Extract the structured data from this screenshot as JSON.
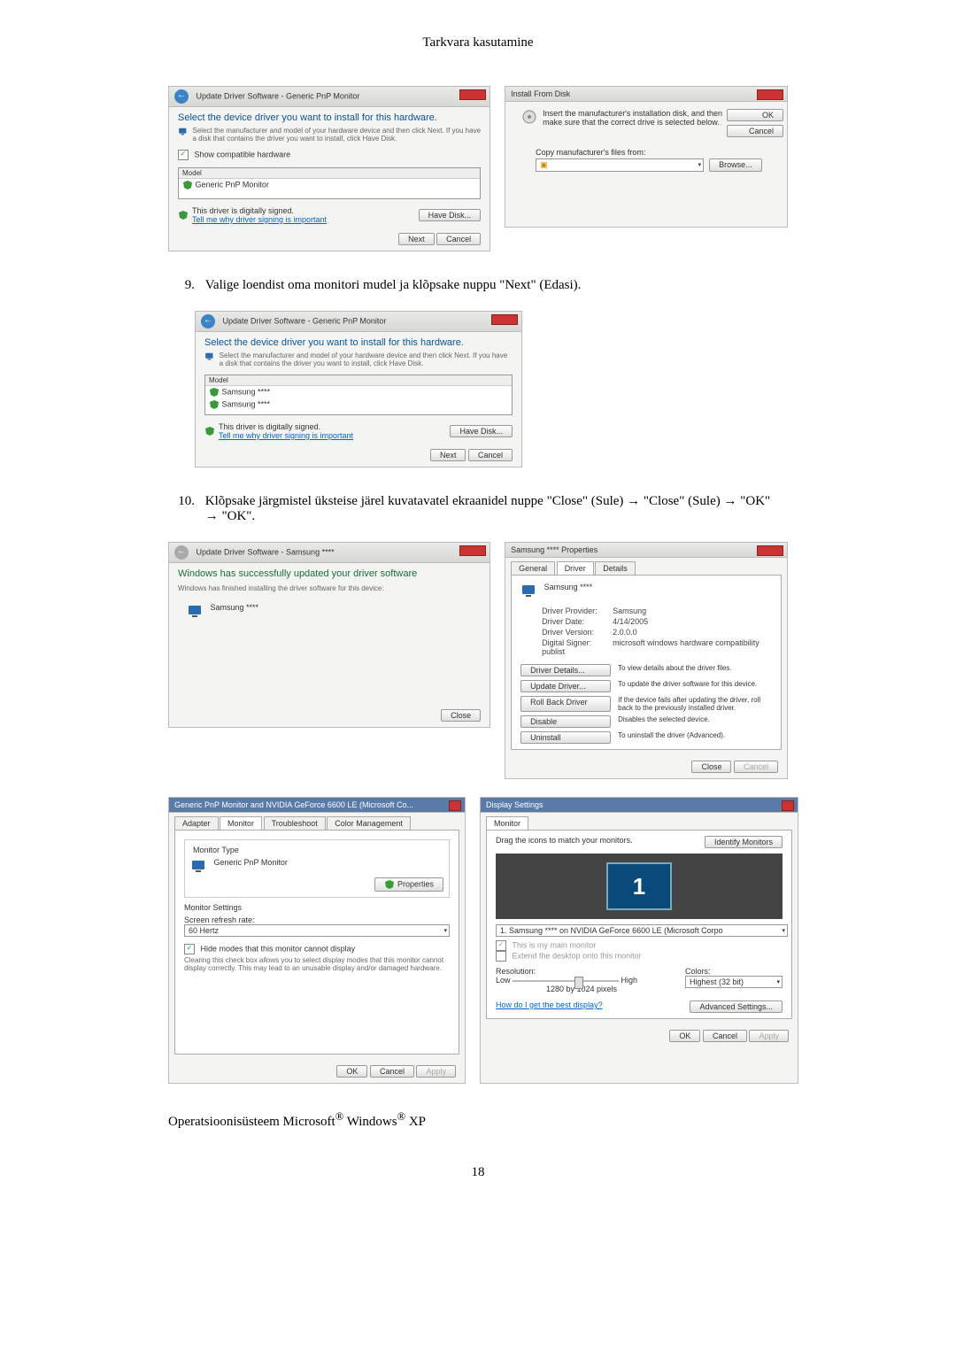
{
  "header": "Tarkvara kasutamine",
  "step9": {
    "num": "9.",
    "text": "Valige loendist oma monitori mudel ja klõpsake nuppu \"Next\" (Edasi)."
  },
  "step10": {
    "num": "10.",
    "text": "Klõpsake järgmistel üksteise järel kuvatavatel ekraanidel nuppe \"Close\" (Sule) → \"Close\" (Sule) → \"OK\" → \"OK\"."
  },
  "dlg1": {
    "title": "Update Driver Software - Generic PnP Monitor",
    "heading": "Select the device driver you want to install for this hardware.",
    "instr": "Select the manufacturer and model of your hardware device and then click Next. If you have a disk that contains the driver you want to install, click Have Disk.",
    "chk": "Show compatible hardware",
    "modelHdr": "Model",
    "modelItem": "Generic PnP Monitor",
    "signed": "This driver is digitally signed.",
    "tellme": "Tell me why driver signing is important",
    "havedisk": "Have Disk...",
    "next": "Next",
    "cancel": "Cancel"
  },
  "dlg2": {
    "title": "Install From Disk",
    "instr": "Insert the manufacturer's installation disk, and then make sure that the correct drive is selected below.",
    "ok": "OK",
    "cancel": "Cancel",
    "copy": "Copy manufacturer's files from:",
    "browse": "Browse..."
  },
  "dlg3": {
    "title": "Update Driver Software - Generic PnP Monitor",
    "heading": "Select the device driver you want to install for this hardware.",
    "instr": "Select the manufacturer and model of your hardware device and then click Next. If you have a disk that contains the driver you want to install, click Have Disk.",
    "modelHdr": "Model",
    "m1": "Samsung ****",
    "m2": "Samsung ****",
    "signed": "This driver is digitally signed.",
    "tellme": "Tell me why driver signing is important",
    "havedisk": "Have Disk...",
    "next": "Next",
    "cancel": "Cancel"
  },
  "dlg4": {
    "title": "Update Driver Software - Samsung ****",
    "heading": "Windows has successfully updated your driver software",
    "sub": "Windows has finished installing the driver software for this device:",
    "device": "Samsung ****",
    "close": "Close"
  },
  "dlg5": {
    "title": "Samsung **** Properties",
    "tabs": {
      "general": "General",
      "driver": "Driver",
      "details": "Details"
    },
    "device": "Samsung ****",
    "provider_lbl": "Driver Provider:",
    "provider": "Samsung",
    "date_lbl": "Driver Date:",
    "date": "4/14/2005",
    "version_lbl": "Driver Version:",
    "version": "2.0.0.0",
    "signer_lbl": "Digital Signer:",
    "signer": "microsoft windows hardware compatibility publist",
    "b_details": "Driver Details...",
    "b_details_d": "To view details about the driver files.",
    "b_update": "Update Driver...",
    "b_update_d": "To update the driver software for this device.",
    "b_roll": "Roll Back Driver",
    "b_roll_d": "If the device fails after updating the driver, roll back to the previously installed driver.",
    "b_dis": "Disable",
    "b_dis_d": "Disables the selected device.",
    "b_unin": "Uninstall",
    "b_unin_d": "To uninstall the driver (Advanced).",
    "close": "Close",
    "cancel": "Cancel"
  },
  "dlg6": {
    "title": "Generic PnP Monitor and NVIDIA GeForce 6600 LE (Microsoft Co...",
    "tabs": {
      "adapter": "Adapter",
      "monitor": "Monitor",
      "trouble": "Troubleshoot",
      "color": "Color Management"
    },
    "montype": "Monitor Type",
    "monname": "Generic PnP Monitor",
    "properties": "Properties",
    "monset": "Monitor Settings",
    "refresh_lbl": "Screen refresh rate:",
    "refresh": "60 Hertz",
    "hidechk": "Hide modes that this monitor cannot display",
    "hidetxt": "Clearing this check box allows you to select display modes that this monitor cannot display correctly. This may lead to an unusable display and/or damaged hardware.",
    "ok": "OK",
    "cancel": "Cancel",
    "apply": "Apply"
  },
  "dlg7": {
    "title": "Display Settings",
    "tab": "Monitor",
    "drag": "Drag the icons to match your monitors.",
    "identify": "Identify Monitors",
    "num": "1",
    "monsel": "1. Samsung **** on NVIDIA GeForce 6600 LE (Microsoft Corpo",
    "main": "This is my main monitor",
    "extend": "Extend the desktop onto this monitor",
    "res_lbl": "Resolution:",
    "low": "Low",
    "high": "High",
    "res": "1280 by 1024 pixels",
    "col_lbl": "Colors:",
    "col": "Highest (32 bit)",
    "help": "How do I get the best display?",
    "adv": "Advanced Settings...",
    "ok": "OK",
    "cancel": "Cancel",
    "apply": "Apply"
  },
  "os": {
    "pre": "Operatsioonisüsteem Microsoft",
    "mid": " Windows",
    "suf": " XP",
    "reg": "®"
  },
  "pagenum": "18"
}
